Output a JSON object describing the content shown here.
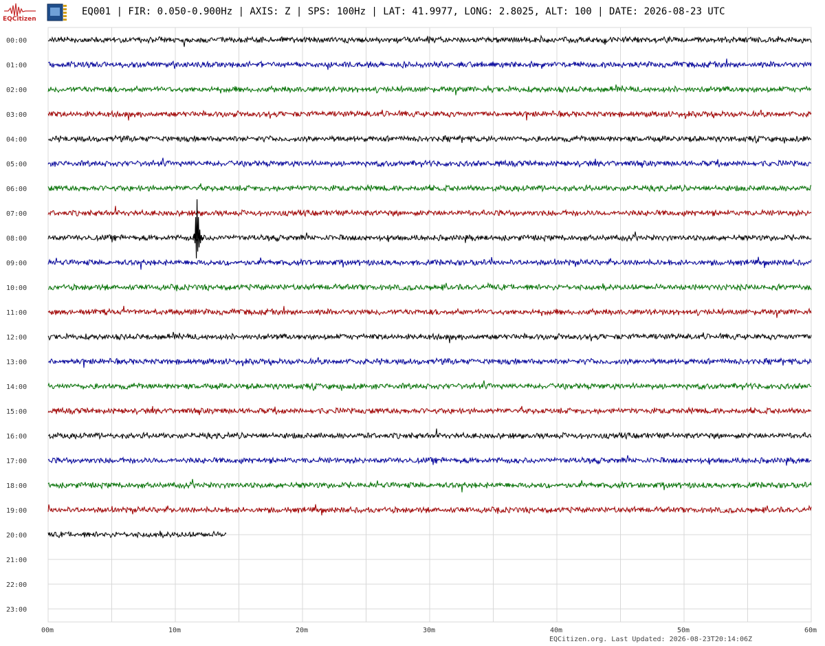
{
  "header": {
    "logo_text": "EQCitizen",
    "title": "EQ001 | FIR: 0.050-0.900Hz | AXIS: Z | SPS: 100Hz | LAT: 41.9977, LONG: 2.8025, ALT: 100 | DATE: 2026-08-23 UTC"
  },
  "footer": {
    "text": "EQCitizen.org. Last Updated: 2026-08-23T20:14:06Z"
  },
  "colors": {
    "trace_cycle": [
      "#000000",
      "#00009a",
      "#007000",
      "#a00000"
    ],
    "grid": "#d8d8d8",
    "logo": "#c62828"
  },
  "chart_data": {
    "type": "line",
    "title": "",
    "xlabel": "",
    "ylabel": "",
    "x_ticks": [
      "00m",
      "10m",
      "20m",
      "30m",
      "40m",
      "50m",
      "60m"
    ],
    "x_range_minutes": [
      0,
      60
    ],
    "grid": true,
    "rows": [
      {
        "label": "00:00",
        "minutes": 60
      },
      {
        "label": "01:00",
        "minutes": 60
      },
      {
        "label": "02:00",
        "minutes": 60
      },
      {
        "label": "03:00",
        "minutes": 60
      },
      {
        "label": "04:00",
        "minutes": 60
      },
      {
        "label": "05:00",
        "minutes": 60
      },
      {
        "label": "06:00",
        "minutes": 60
      },
      {
        "label": "07:00",
        "minutes": 60
      },
      {
        "label": "08:00",
        "minutes": 60
      },
      {
        "label": "09:00",
        "minutes": 60
      },
      {
        "label": "10:00",
        "minutes": 60
      },
      {
        "label": "11:00",
        "minutes": 60
      },
      {
        "label": "12:00",
        "minutes": 60
      },
      {
        "label": "13:00",
        "minutes": 60
      },
      {
        "label": "14:00",
        "minutes": 60
      },
      {
        "label": "15:00",
        "minutes": 60
      },
      {
        "label": "16:00",
        "minutes": 60
      },
      {
        "label": "17:00",
        "minutes": 60
      },
      {
        "label": "18:00",
        "minutes": 60
      },
      {
        "label": "19:00",
        "minutes": 60
      },
      {
        "label": "20:00",
        "minutes": 14
      },
      {
        "label": "21:00",
        "minutes": 0
      },
      {
        "label": "22:00",
        "minutes": 0
      },
      {
        "label": "23:00",
        "minutes": 0
      }
    ],
    "events": [
      {
        "row": "08:00",
        "minute": 11.6
      }
    ]
  }
}
